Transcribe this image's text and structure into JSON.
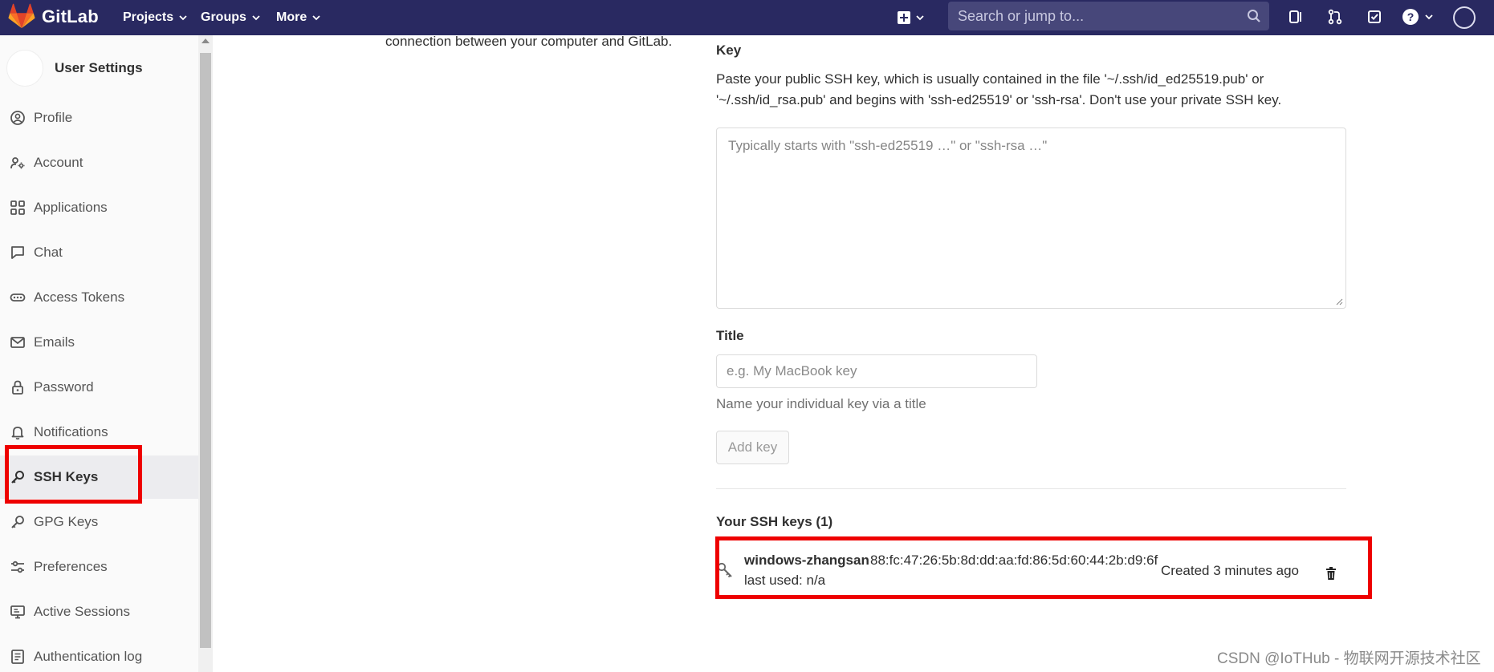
{
  "navbar": {
    "brand": "GitLab",
    "menus": [
      {
        "label": "Projects"
      },
      {
        "label": "Groups"
      },
      {
        "label": "More"
      }
    ],
    "search_placeholder": "Search or jump to...",
    "background": "#292961"
  },
  "sidebar": {
    "context_title": "User Settings",
    "items": [
      {
        "label": "Profile",
        "icon": "profile-icon"
      },
      {
        "label": "Account",
        "icon": "account-icon"
      },
      {
        "label": "Applications",
        "icon": "applications-icon"
      },
      {
        "label": "Chat",
        "icon": "chat-icon"
      },
      {
        "label": "Access Tokens",
        "icon": "token-icon"
      },
      {
        "label": "Emails",
        "icon": "mail-icon"
      },
      {
        "label": "Password",
        "icon": "lock-icon"
      },
      {
        "label": "Notifications",
        "icon": "bell-icon"
      },
      {
        "label": "SSH Keys",
        "icon": "key-icon",
        "active": true
      },
      {
        "label": "GPG Keys",
        "icon": "key-icon"
      },
      {
        "label": "Preferences",
        "icon": "preferences-icon"
      },
      {
        "label": "Active Sessions",
        "icon": "monitor-icon"
      },
      {
        "label": "Authentication log",
        "icon": "log-icon"
      }
    ]
  },
  "main": {
    "intro_fragment": "connection between your computer and GitLab.",
    "key_label": "Key",
    "key_help_line1": "Paste your public SSH key, which is usually contained in the file '~/.ssh/id_ed25519.pub' or",
    "key_help_line2": "'~/.ssh/id_rsa.pub' and begins with 'ssh-ed25519' or 'ssh-rsa'. Don't use your private SSH key.",
    "key_placeholder": "Typically starts with \"ssh-ed25519 …\" or \"ssh-rsa …\"",
    "title_label": "Title",
    "title_placeholder": "e.g. My MacBook key",
    "title_help": "Name your individual key via a title",
    "add_key_label": "Add key",
    "ssh_keys_heading": "Your SSH keys (1)",
    "keys": [
      {
        "title": "windows-zhangsan",
        "fingerprint": "88:fc:47:26:5b:8d:dd:aa:fd:86:5d:60:44:2b:d9:6f",
        "last_used": "last used: n/a",
        "created": "Created 3 minutes ago"
      }
    ]
  },
  "watermark": "CSDN @IoTHub - 物联网开源技术社区",
  "colors": {
    "highlight": "#ee0000",
    "active_item_bg": "#ececef"
  }
}
